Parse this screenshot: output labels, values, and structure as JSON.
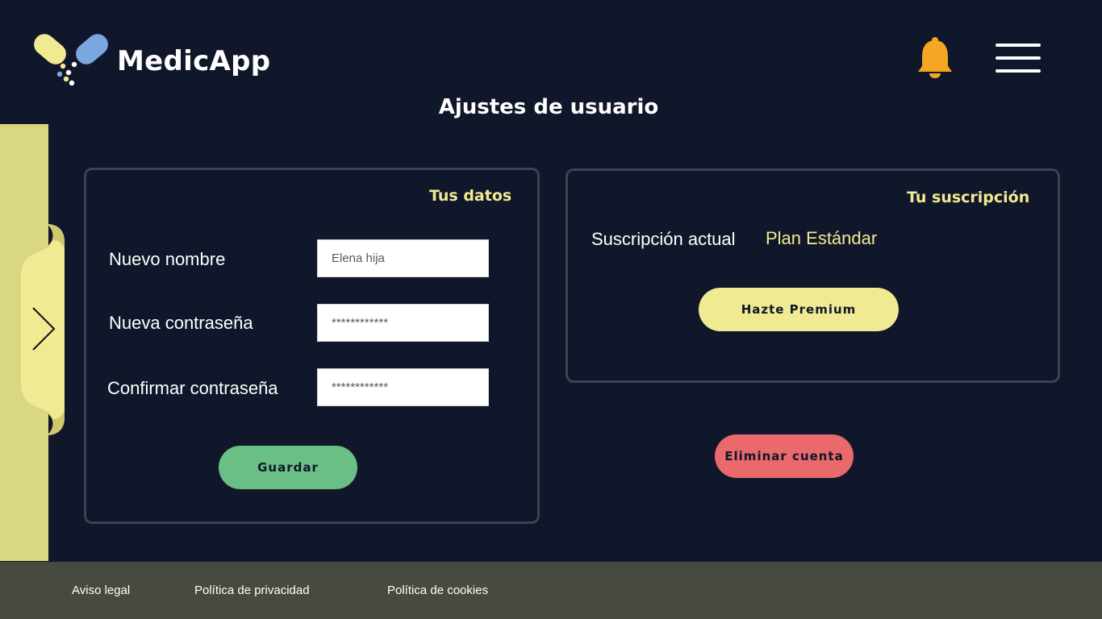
{
  "header": {
    "app_name": "MedicApp",
    "logo_icon": "pill-capsule-logo",
    "notification_icon": "bell-icon",
    "menu_icon": "hamburger-menu-icon"
  },
  "page_title": "Ajustes de usuario",
  "sidebar": {
    "toggle_icon": "chevron-right-icon"
  },
  "profile": {
    "heading": "Tus datos",
    "fields": [
      {
        "label": "Nuevo nombre",
        "value": "Elena hija"
      },
      {
        "label": "Nueva contraseña",
        "value": "************"
      },
      {
        "label": "Confirmar contraseña",
        "value": "************"
      }
    ],
    "save_label": "Guardar"
  },
  "subscription": {
    "heading": "Tu suscripción",
    "current_label": "Suscripción actual",
    "current_value": "Plan Estándar",
    "premium_label": "Hazte Premium"
  },
  "delete_label": "Eliminar cuenta",
  "footer": {
    "links": [
      "Aviso legal",
      "Política de privacidad",
      "Política de cookies"
    ]
  },
  "colors": {
    "background": "#11172a",
    "accent_yellow": "#f0ea93",
    "save_green": "#6abf85",
    "delete_red": "#e9696c",
    "sidebar": "#d9d784",
    "bell": "#f5a623",
    "footer": "#474a3f",
    "logo_blue": "#7aa7df"
  }
}
